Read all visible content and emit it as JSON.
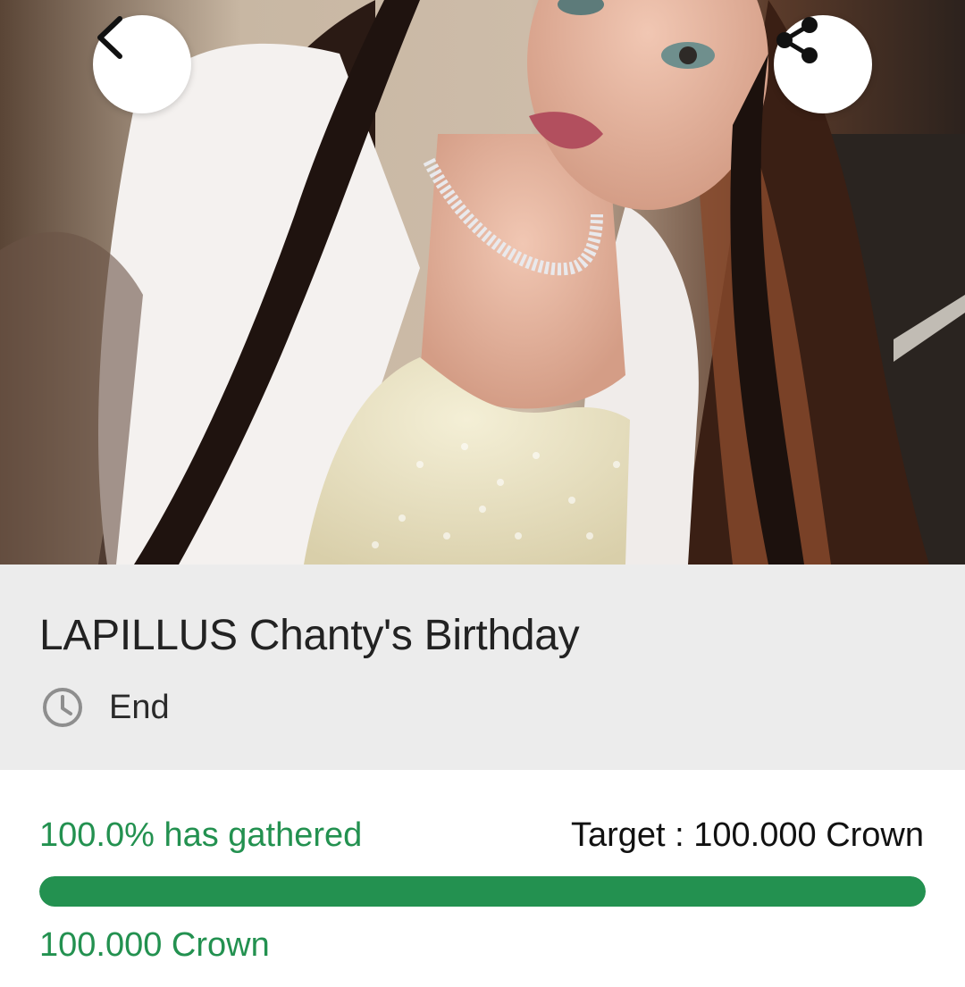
{
  "hero": {
    "image_alt": "Portrait photo of a person with long dark hair wearing a white jacket and a pearl top"
  },
  "header": {
    "back_icon": "chevron-left-icon",
    "share_icon": "share-icon"
  },
  "event": {
    "title": "LAPILLUS Chanty's Birthday",
    "status_icon": "clock-icon",
    "status": "End"
  },
  "funding": {
    "gathered_text": "100.0% has gathered",
    "target_text": "Target : 100.000 Crown",
    "progress_fraction": 1.0,
    "amount_text": "100.000 Crown"
  },
  "colors": {
    "accent_green": "#239150",
    "panel_gray": "#ececec",
    "progress_track": "#d9d9d9"
  }
}
